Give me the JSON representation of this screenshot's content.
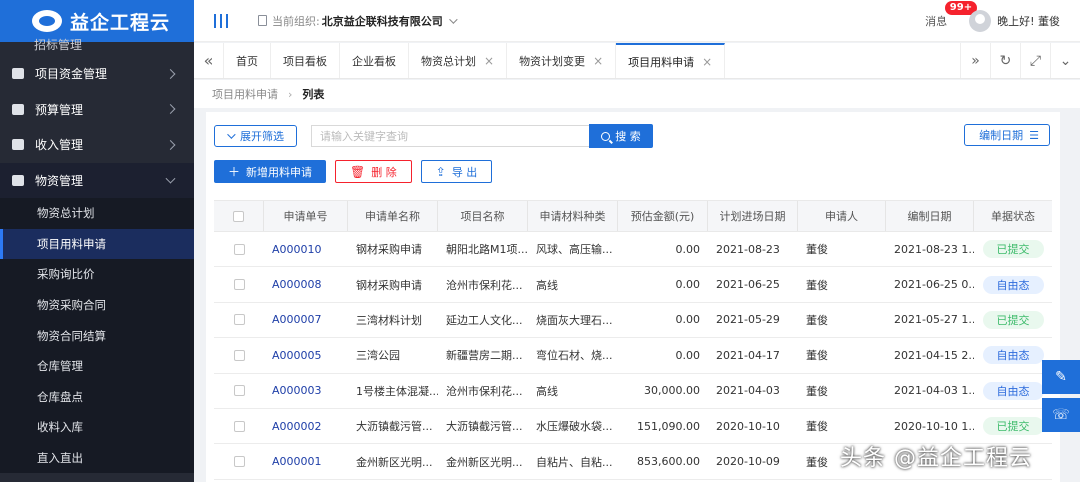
{
  "app": {
    "logo_text": "益企工程云"
  },
  "sidebar": {
    "partial_item": "招标管理",
    "items": [
      {
        "label": "项目资金管理"
      },
      {
        "label": "预算管理"
      },
      {
        "label": "收入管理"
      },
      {
        "label": "物资管理"
      }
    ],
    "sub_items": [
      {
        "label": "物资总计划"
      },
      {
        "label": "项目用料申请"
      },
      {
        "label": "采购询比价"
      },
      {
        "label": "物资采购合同"
      },
      {
        "label": "物资合同结算"
      },
      {
        "label": "仓库管理"
      },
      {
        "label": "仓库盘点"
      },
      {
        "label": "收料入库"
      },
      {
        "label": "直入直出"
      }
    ]
  },
  "header": {
    "org_label": "当前组织:",
    "org_name": "北京益企联科技有限公司",
    "messages_label": "消息",
    "messages_badge": "99+",
    "greeting": "晚上好! 董俊"
  },
  "tabs": [
    {
      "label": "首页"
    },
    {
      "label": "项目看板"
    },
    {
      "label": "企业看板"
    },
    {
      "label": "物资总计划"
    },
    {
      "label": "物资计划变更"
    },
    {
      "label": "项目用料申请"
    }
  ],
  "breadcrumb": {
    "parent": "项目用料申请",
    "current": "列表"
  },
  "toolbar": {
    "filter_label": "展开筛选",
    "search_placeholder": "请输入关键字查询",
    "search_label": "搜 索",
    "sort_label": "编制日期",
    "add_label": "新增用料申请",
    "delete_label": "删 除",
    "export_label": "导 出"
  },
  "table": {
    "columns": [
      "申请单号",
      "申请单名称",
      "项目名称",
      "申请材料种类",
      "预估金额(元)",
      "计划进场日期",
      "申请人",
      "编制日期",
      "单据状态"
    ],
    "rows": [
      {
        "no": "A000010",
        "name": "钢材采购申请",
        "project": "朝阳北路M1项...",
        "material": "风球、高压输...",
        "amount": "0.00",
        "plan_date": "2021-08-23",
        "applicant": "董俊",
        "edit_date": "2021-08-23 1...",
        "status": "已提交",
        "status_type": "submitted"
      },
      {
        "no": "A000008",
        "name": "钢材采购申请",
        "project": "沧州市保利花...",
        "material": "高线",
        "amount": "0.00",
        "plan_date": "2021-06-25",
        "applicant": "董俊",
        "edit_date": "2021-06-25 0...",
        "status": "自由态",
        "status_type": "draft"
      },
      {
        "no": "A000007",
        "name": "三湾材料计划",
        "project": "延边工人文化...",
        "material": "烧面灰大理石...",
        "amount": "0.00",
        "plan_date": "2021-05-29",
        "applicant": "董俊",
        "edit_date": "2021-05-27 1...",
        "status": "已提交",
        "status_type": "submitted"
      },
      {
        "no": "A000005",
        "name": "三湾公园",
        "project": "新疆营房二期...",
        "material": "弯位石材、烧...",
        "amount": "0.00",
        "plan_date": "2021-04-17",
        "applicant": "董俊",
        "edit_date": "2021-04-15 2...",
        "status": "自由态",
        "status_type": "draft"
      },
      {
        "no": "A000003",
        "name": "1号楼主体混凝...",
        "project": "沧州市保利花...",
        "material": "高线",
        "amount": "30,000.00",
        "plan_date": "2021-04-03",
        "applicant": "董俊",
        "edit_date": "2021-04-03 1...",
        "status": "自由态",
        "status_type": "draft"
      },
      {
        "no": "A000002",
        "name": "大沥镇截污管...",
        "project": "大沥镇截污管...",
        "material": "水压爆破水袋...",
        "amount": "151,090.00",
        "plan_date": "2020-10-10",
        "applicant": "董俊",
        "edit_date": "2020-10-10 1...",
        "status": "已提交",
        "status_type": "submitted"
      },
      {
        "no": "A000001",
        "name": "金州新区光明...",
        "project": "金州新区光明...",
        "material": "自粘片、自粘...",
        "amount": "853,600.00",
        "plan_date": "2020-10-09",
        "applicant": "董俊",
        "edit_date": "",
        "status": "",
        "status_type": ""
      }
    ]
  },
  "watermark": "头条 @益企工程云",
  "colors": {
    "brand": "#1f6fd9",
    "sidebar_bg": "#262a35",
    "danger": "#f5222d",
    "success": "#3dbb6b"
  }
}
